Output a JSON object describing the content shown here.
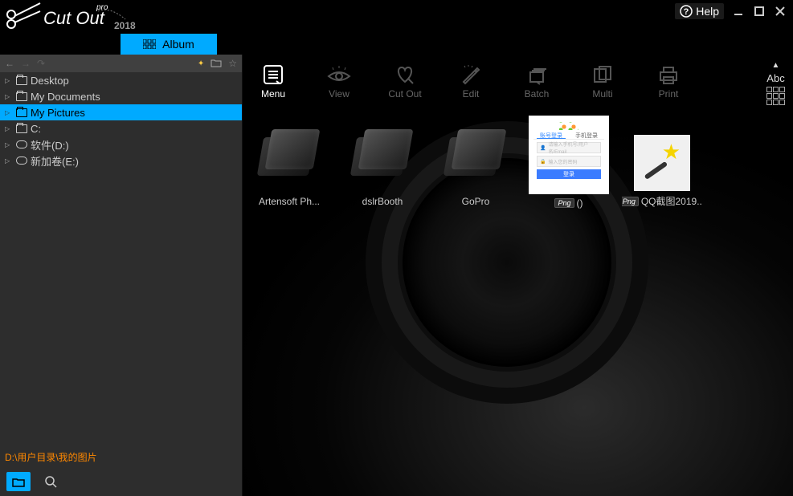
{
  "app": {
    "name": "Cut Out",
    "edition": "pro",
    "year": "2018"
  },
  "window": {
    "help": "Help"
  },
  "tabs": {
    "album": "Album"
  },
  "sidebar": {
    "items": [
      {
        "label": "Desktop",
        "icon": "folder"
      },
      {
        "label": "My Documents",
        "icon": "folder"
      },
      {
        "label": "My Pictures",
        "icon": "folder",
        "selected": true
      },
      {
        "label": "C:",
        "icon": "folder"
      },
      {
        "label": "软件(D:)",
        "icon": "drive"
      },
      {
        "label": "新加卷(E:)",
        "icon": "drive"
      }
    ],
    "path": "D:\\用户目录\\我的图片"
  },
  "toolbar": {
    "items": [
      {
        "label": "Menu",
        "active": true
      },
      {
        "label": "View"
      },
      {
        "label": "Cut Out"
      },
      {
        "label": "Edit"
      },
      {
        "label": "Batch"
      },
      {
        "label": "Multi"
      },
      {
        "label": "Print"
      }
    ],
    "sort_label": "Abc"
  },
  "gallery": {
    "items": [
      {
        "label": "Artensoft Ph...",
        "type": "folder"
      },
      {
        "label": "dslrBooth",
        "type": "folder"
      },
      {
        "label": "GoPro",
        "type": "folder"
      },
      {
        "label": "()",
        "type": "png",
        "badge": "Png",
        "thumb": "login"
      },
      {
        "label": "QQ截图2019...",
        "type": "png",
        "badge": "Png",
        "thumb": "wand"
      }
    ],
    "login_thumb": {
      "tab1": "账号登录",
      "tab2": "手机登录",
      "row1": "请输入手机号/用户名/Email",
      "row2": "输入您的密码",
      "btn": "登录"
    }
  }
}
